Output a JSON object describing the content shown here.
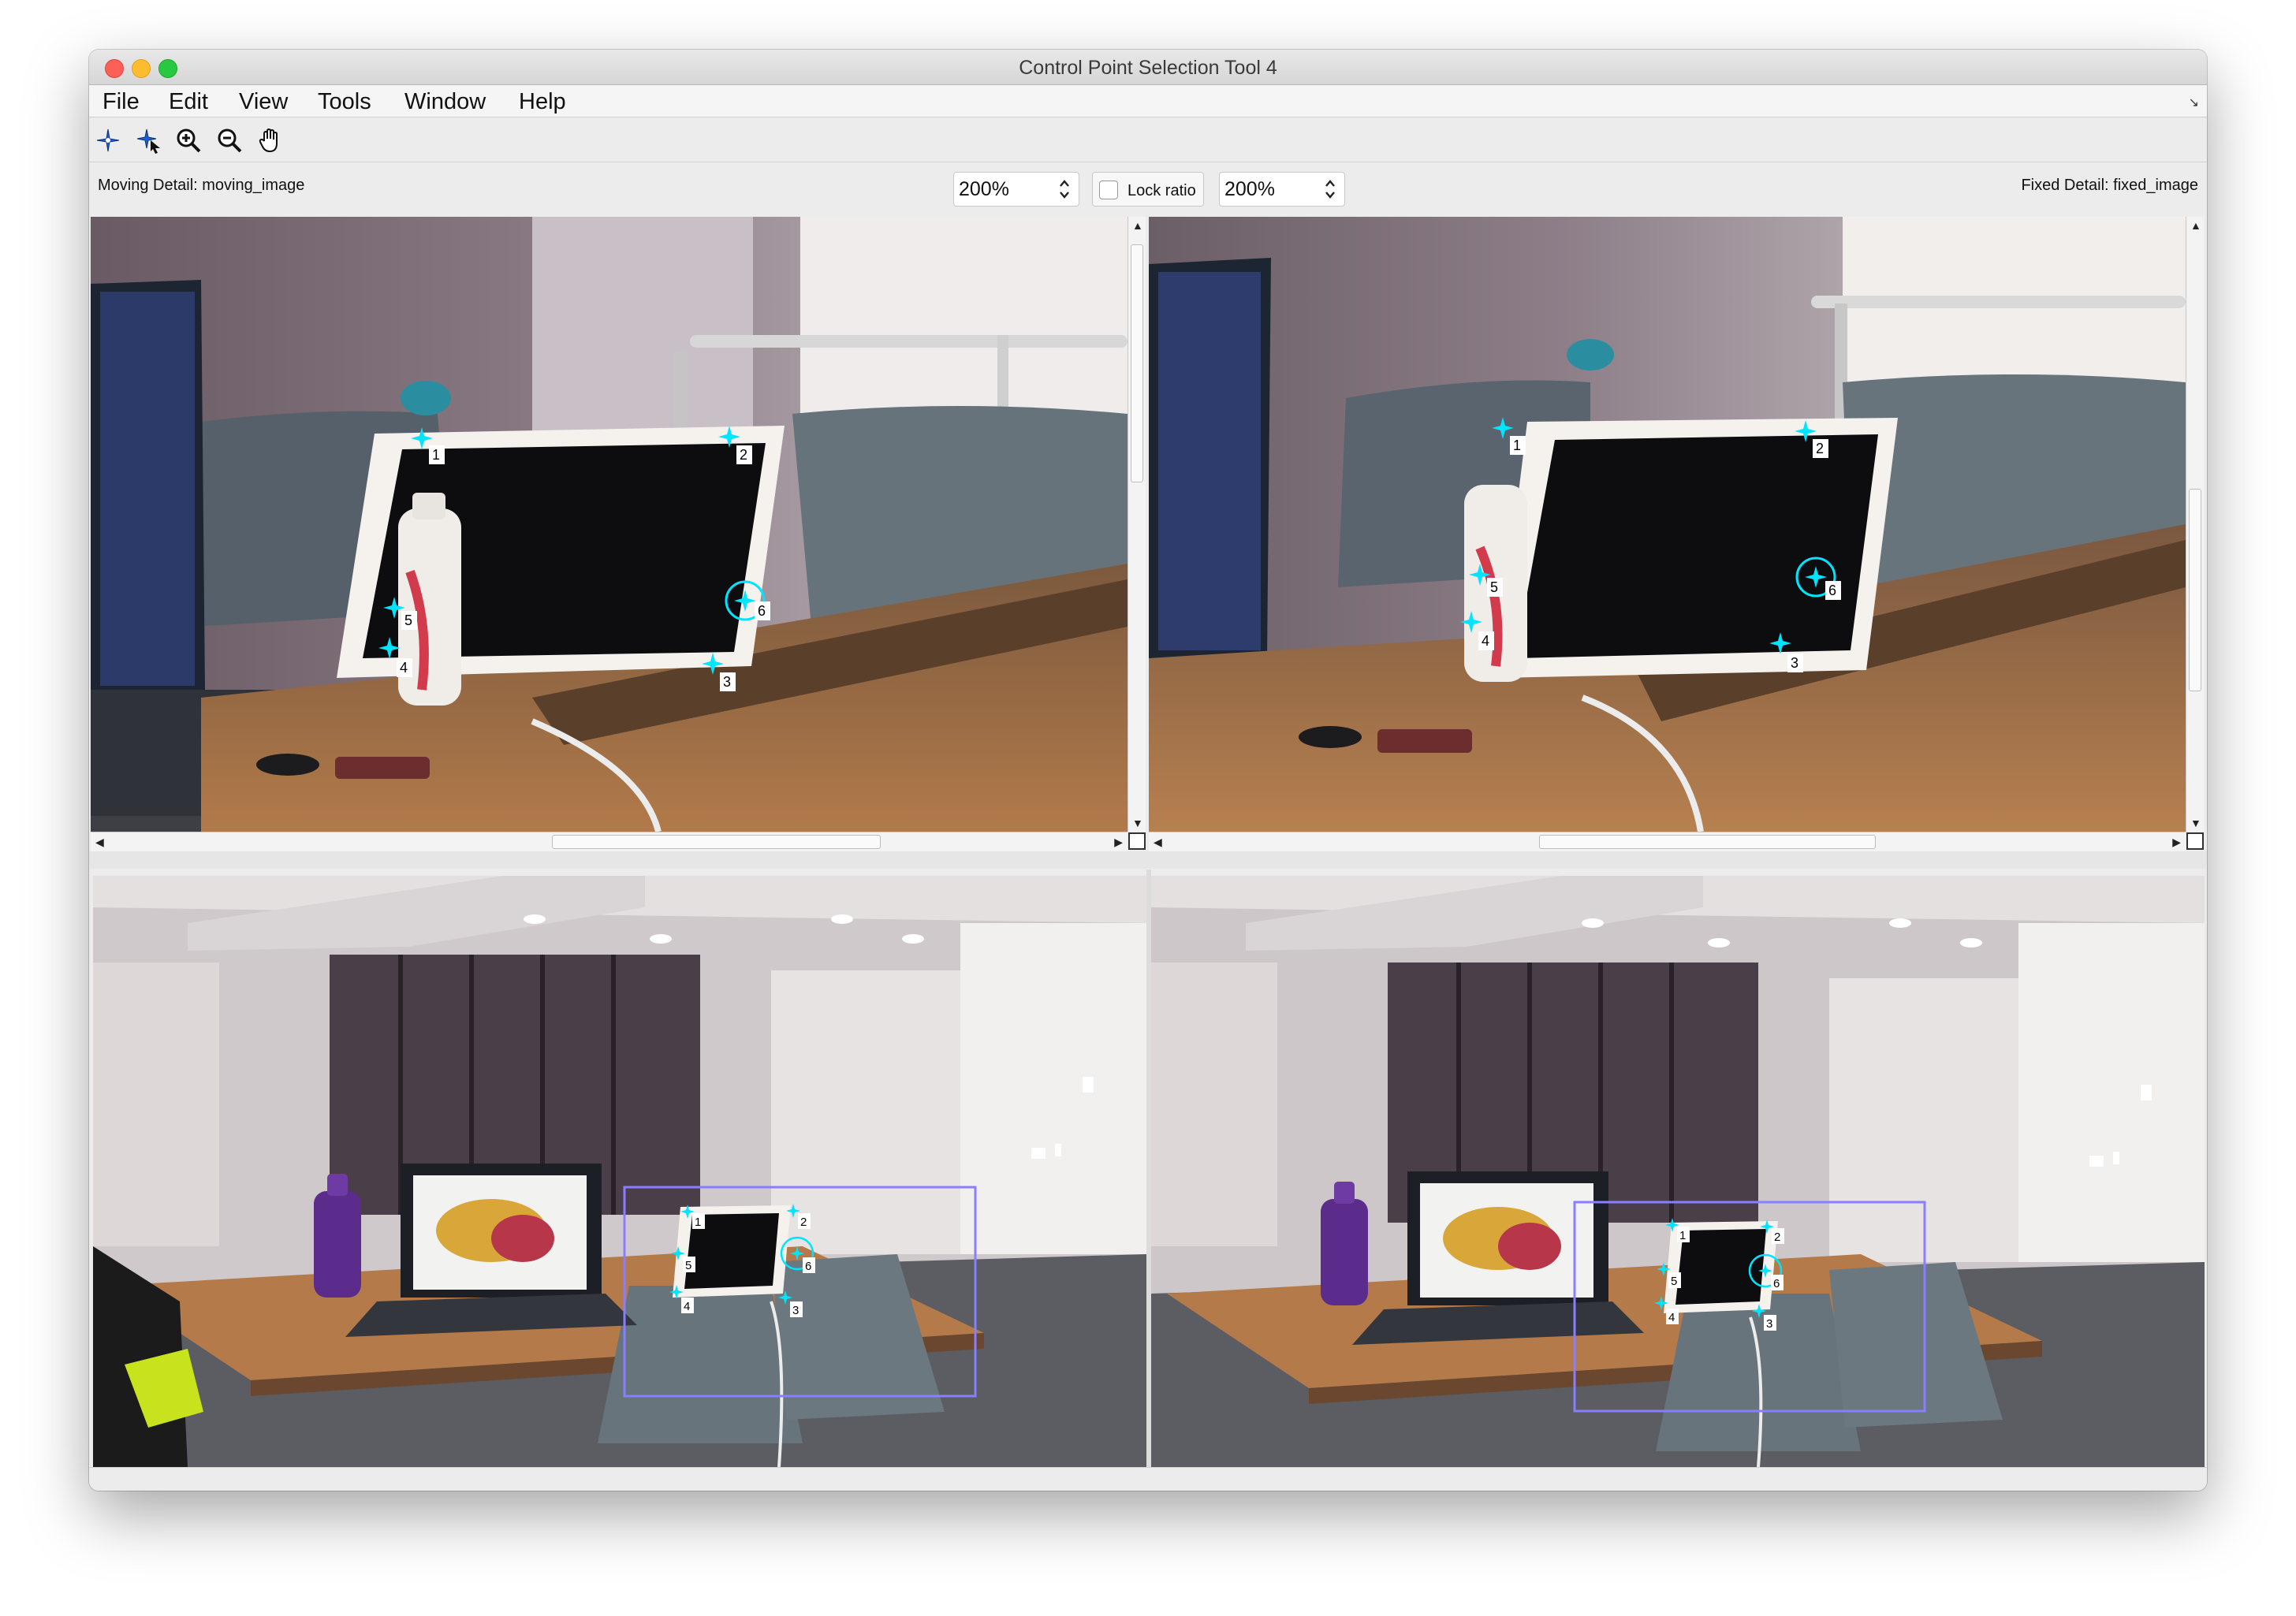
{
  "window": {
    "title": "Control Point Selection Tool 4"
  },
  "menu": [
    {
      "label": "File"
    },
    {
      "label": "Edit"
    },
    {
      "label": "View"
    },
    {
      "label": "Tools"
    },
    {
      "label": "Window"
    },
    {
      "label": "Help"
    }
  ],
  "toolbar": {
    "tools": [
      {
        "name": "add-point-icon"
      },
      {
        "name": "select-point-icon"
      },
      {
        "name": "zoom-in-icon"
      },
      {
        "name": "zoom-out-icon"
      },
      {
        "name": "pan-hand-icon"
      }
    ]
  },
  "moving": {
    "label": "Moving Detail: moving_image",
    "zoom": "200%"
  },
  "fixed": {
    "label": "Fixed Detail: fixed_image",
    "zoom": "200%"
  },
  "lock_ratio": {
    "label": "Lock ratio",
    "checked": false
  },
  "control_points": {
    "labels": [
      "1",
      "2",
      "3",
      "4",
      "5",
      "6"
    ],
    "color": "#00e5ff",
    "selected": "6"
  },
  "colors": {
    "marker": "#00e5ff",
    "overview_box": "#8a7dff",
    "accent": "#2e6bd6"
  }
}
